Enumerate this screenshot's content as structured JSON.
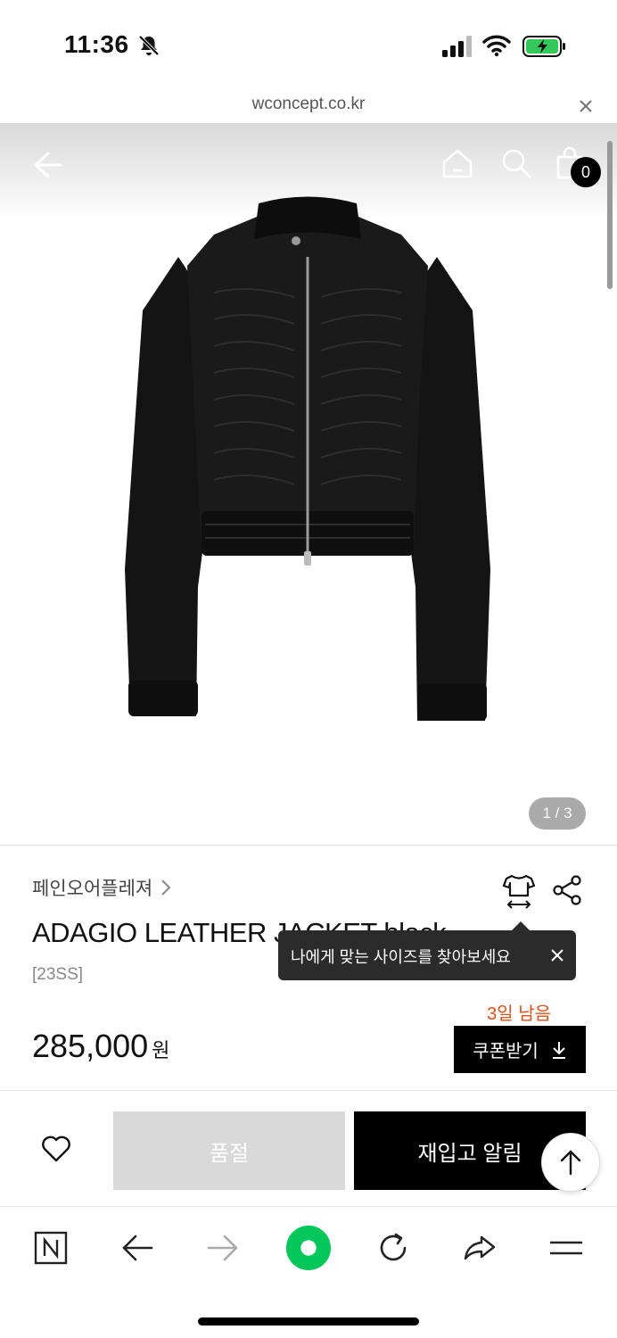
{
  "status_bar": {
    "time": "11:36"
  },
  "browser": {
    "url": "wconcept.co.kr"
  },
  "header": {
    "cart_count": "0"
  },
  "gallery": {
    "page_indicator": "1 / 3"
  },
  "product": {
    "brand": "페인오어플레져",
    "title": "ADAGIO LEATHER JACKET black",
    "season": "[23SS]",
    "price": "285,000",
    "currency": "원",
    "coupon_days_left": "3일 남음",
    "coupon_label": "쿠폰받기"
  },
  "tooltip": {
    "text": "나에게 맞는 사이즈를 찾아보세요"
  },
  "actions": {
    "soldout_label": "품절",
    "restock_label": "재입고 알림"
  },
  "colors": {
    "accent_orange": "#d9531e",
    "naver_green": "#03c75a",
    "soldout_gray": "#d9d9d9"
  }
}
